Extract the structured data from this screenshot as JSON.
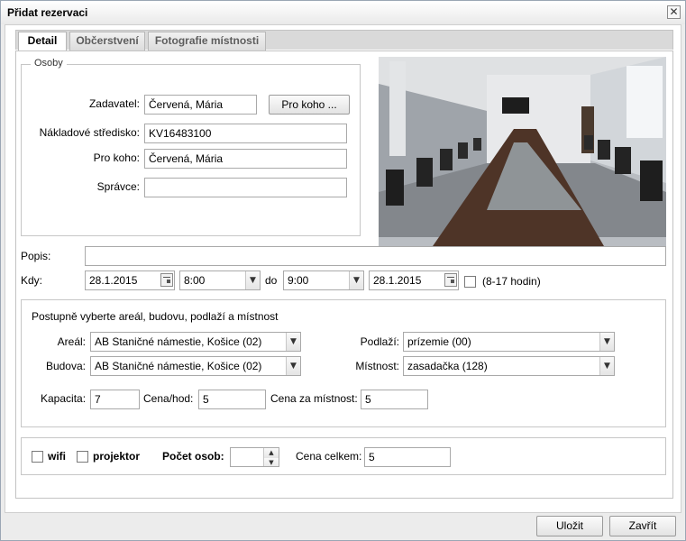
{
  "dialog": {
    "title": "Přidat rezervaci",
    "close_glyph": "✕",
    "tabs": [
      {
        "label": "Detail",
        "active": true
      },
      {
        "label": "Občerstvení",
        "active": false
      },
      {
        "label": "Fotografie místnosti",
        "active": false
      }
    ]
  },
  "osoby": {
    "legend": "Osoby",
    "zadavatel_label": "Zadavatel:",
    "zadavatel_value": "Červená, Mária",
    "pro_koho_button": "Pro koho ...",
    "nakladove_label": "Nákladové středisko:",
    "nakladove_value": "KV16483100",
    "pro_koho_label": "Pro koho:",
    "pro_koho_value": "Červená, Mária",
    "spravce_label": "Správce:",
    "spravce_value": ""
  },
  "popis": {
    "label": "Popis:",
    "value": ""
  },
  "kdy": {
    "label": "Kdy:",
    "date_from": "28.1.2015",
    "time_from": "8:00",
    "do_label": "do",
    "time_to": "9:00",
    "date_to": "28.1.2015",
    "hours_note": "(8-17 hodin)"
  },
  "mistnost": {
    "intro": "Postupně vyberte areál, budovu, podlaží a místnost",
    "areal_label": "Areál:",
    "areal_value": "AB Staničné námestie, Košice (02)",
    "budova_label": "Budova:",
    "budova_value": "AB Staničné námestie, Košice (02)",
    "podlazi_label": "Podlaží:",
    "podlazi_value": "prízemie (00)",
    "mistnost_label": "Místnost:",
    "mistnost_value": "zasadačka (128)",
    "kapacita_label": "Kapacita:",
    "kapacita_value": "7",
    "cena_hod_label": "Cena/hod:",
    "cena_hod_value": "5",
    "cena_mistnost_label": "Cena za místnost:",
    "cena_mistnost_value": "5"
  },
  "extras": {
    "wifi_label": "wifi",
    "projektor_label": "projektor",
    "pocet_osob_label": "Počet osob:",
    "pocet_osob_value": "",
    "cena_celkem_label": "Cena celkem:",
    "cena_celkem_value": "5"
  },
  "footer": {
    "save_label": "Uložit",
    "close_label": "Zavřít"
  },
  "icons": {
    "dropdown": "chevron-down-icon",
    "calendar": "calendar-icon",
    "spinner": "spinner-icon"
  },
  "colors": {
    "border": "#a9a9a9",
    "panel_bg": "#ececec",
    "tab_text": "#5d5d5d"
  }
}
